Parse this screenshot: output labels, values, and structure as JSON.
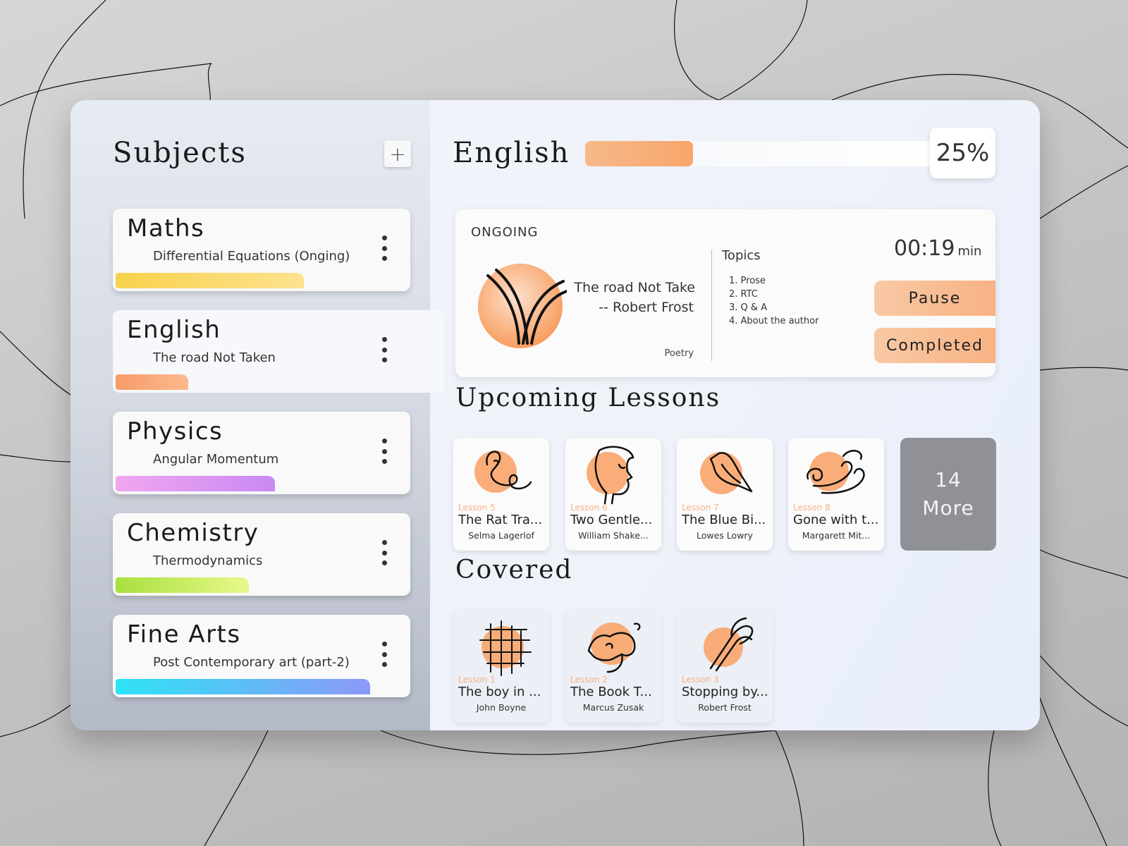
{
  "sidebar": {
    "title": "Subjects",
    "add_icon": "plus-icon",
    "add_label": "+",
    "subjects": [
      {
        "name": "Maths",
        "topic": "Differential Equations (Onging)",
        "progress": 0.65,
        "gradient": [
          "#f8d24d",
          "#fde28e"
        ],
        "active": false
      },
      {
        "name": "English",
        "topic": "The road Not Taken",
        "progress": 0.25,
        "gradient": [
          "#f89b6a",
          "#fbb98e"
        ],
        "active": true
      },
      {
        "name": "Physics",
        "topic": "Angular Momentum",
        "progress": 0.55,
        "gradient": [
          "#f1a6ef",
          "#c889f2"
        ],
        "active": false
      },
      {
        "name": "Chemistry",
        "topic": "Thermodynamics",
        "progress": 0.46,
        "gradient": [
          "#a8e03e",
          "#e8f98a"
        ],
        "active": false
      },
      {
        "name": "Fine Arts",
        "topic": "Post Contemporary art (part-2)",
        "progress": 0.88,
        "gradient": [
          "#2de3f6",
          "#8d98f7"
        ],
        "active": false
      }
    ]
  },
  "main": {
    "title": "English",
    "progress": {
      "value": 0.25,
      "label": "25%",
      "color": "#f8ac78"
    },
    "ongoing": {
      "label": "ONGOING",
      "lesson_title": "The road Not Take",
      "lesson_author": "-- Robert Frost",
      "genre": "Poetry",
      "art_icon": "road-fork-icon",
      "topics_title": "Topics",
      "topics": [
        "1. Prose",
        "2. RTC",
        "3. Q & A",
        "4. About the author"
      ],
      "timer": "00:19",
      "timer_unit": "min",
      "pause_label": "Pause",
      "completed_label": "Completed"
    },
    "upcoming_title": "Upcoming Lessons",
    "upcoming": [
      {
        "lesson": "Lesson 5",
        "title": "The Rat Tra...",
        "author": "Selma Lagerlof",
        "icon": "rat-icon"
      },
      {
        "lesson": "Lesson 6",
        "title": "Two Gentle...",
        "author": "William Shake...",
        "icon": "face-profile-icon"
      },
      {
        "lesson": "Lesson 7",
        "title": "The Blue Bi...",
        "author": "Lowes Lowry",
        "icon": "bird-icon"
      },
      {
        "lesson": "Lesson 8",
        "title": "Gone with t...",
        "author": "Margarett Mit...",
        "icon": "wind-icon"
      }
    ],
    "more": {
      "count": "14",
      "label": "More"
    },
    "covered_title": "Covered",
    "covered": [
      {
        "lesson": "Lesson 1",
        "title": "The boy in ...",
        "author": "John Boyne",
        "icon": "grid-stripes-icon"
      },
      {
        "lesson": "Lesson 2",
        "title": "The Book T...",
        "author": "Marcus Zusak",
        "icon": "book-thief-icon"
      },
      {
        "lesson": "Lesson 3",
        "title": "Stopping by...",
        "author": "Robert Frost",
        "icon": "horse-icon"
      }
    ]
  },
  "colors": {
    "accent": "#f8ac78",
    "accent_circle": "#f9a46a"
  }
}
